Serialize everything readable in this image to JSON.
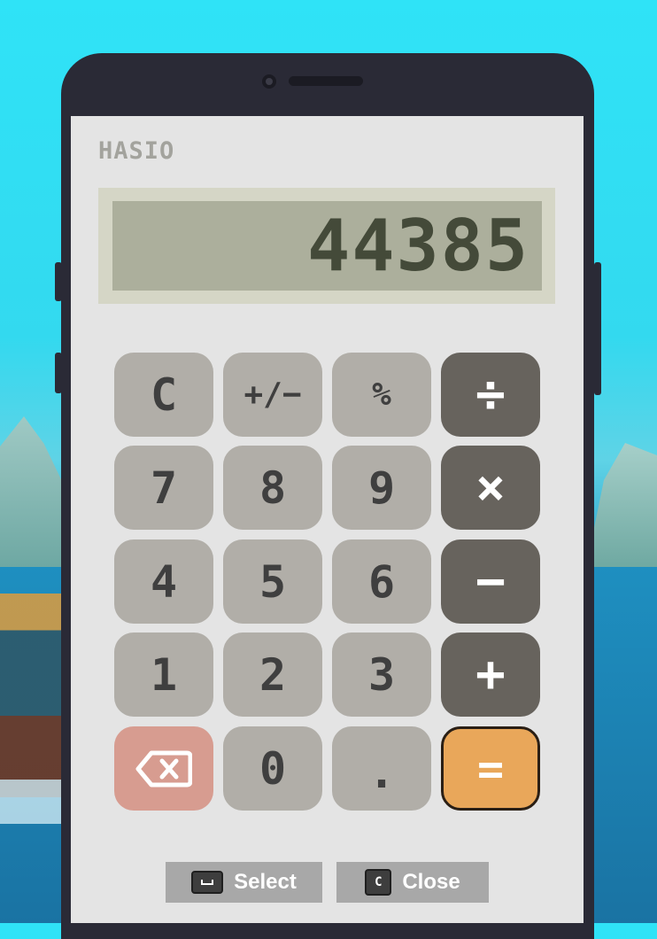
{
  "brand": "HASIO",
  "display": {
    "value": "44385"
  },
  "keys": {
    "clear": "C",
    "sign": "+/−",
    "percent": "%",
    "divide": "÷",
    "seven": "7",
    "eight": "8",
    "nine": "9",
    "multiply": "×",
    "four": "4",
    "five": "5",
    "six": "6",
    "subtract": "−",
    "one": "1",
    "two": "2",
    "three": "3",
    "add": "+",
    "zero": "0",
    "decimal": ".",
    "equals": "="
  },
  "icons": {
    "backspace": "backspace-icon",
    "space_key": "space-key-icon",
    "c_key": "c-key-icon"
  },
  "hints": {
    "select": {
      "key": "␣",
      "label": "Select"
    },
    "close": {
      "key": "C",
      "label": "Close"
    }
  },
  "colors": {
    "sky": "#2fe3f7",
    "phone_frame": "#2a2a36",
    "screen": "#e4e4e4",
    "lcd": "#acaf9c",
    "lcd_text": "#444a39",
    "key_num": "#b1aea8",
    "key_op": "#67635d",
    "key_back": "#d79c90",
    "key_equals": "#e9a75a"
  }
}
